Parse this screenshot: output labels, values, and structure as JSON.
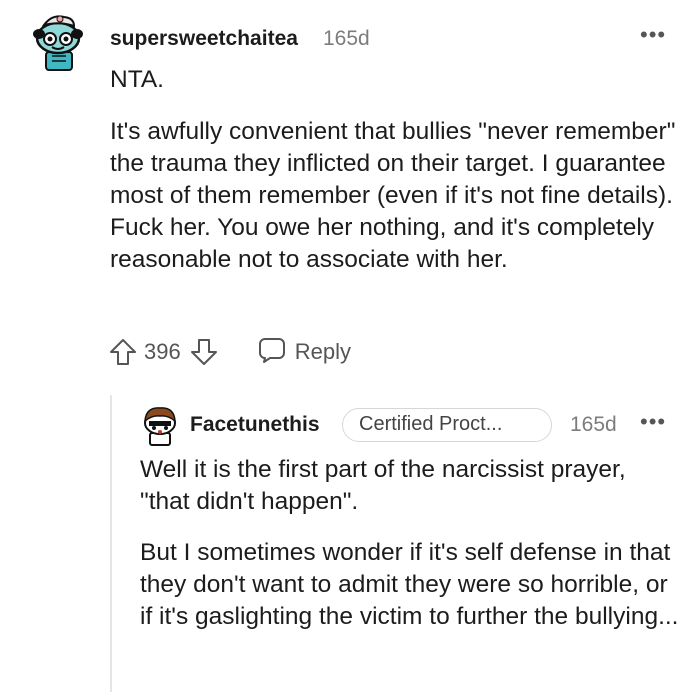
{
  "comment": {
    "username": "supersweetchaitea",
    "age": "165d",
    "more": "•••",
    "paragraphs": [
      "NTA.",
      "It's awfully convenient that bullies \"never remember\" the trauma they inflicted on their target. I guarantee most of them remember (even if it's not fine details). Fuck her. You owe her nothing, and it's completely reasonable not to associate with her."
    ],
    "score": "396",
    "reply_label": "Reply"
  },
  "reply": {
    "username": "Facetunethis",
    "flair": "Certified Proct...",
    "age": "165d",
    "more": "•••",
    "paragraphs": [
      "Well it is the first part of the narcissist prayer, \"that didn't happen\".",
      "But I sometimes wonder if it's self defense in that they don't want to admit they were so horrible, or if it's gaslighting the victim to further the bullying..."
    ]
  },
  "colors": {
    "text": "#1c1c1c",
    "meta": "#7c7c7c",
    "action": "#555555",
    "thread_line": "#e5e5e5",
    "avatar1_accent": "#3fb8c4",
    "avatar2_accent": "#8b4a1d"
  },
  "icons": {
    "upvote": "arrow-up-outline",
    "downvote": "arrow-down-outline",
    "reply": "speech-bubble-outline",
    "more": "ellipsis-horizontal"
  }
}
